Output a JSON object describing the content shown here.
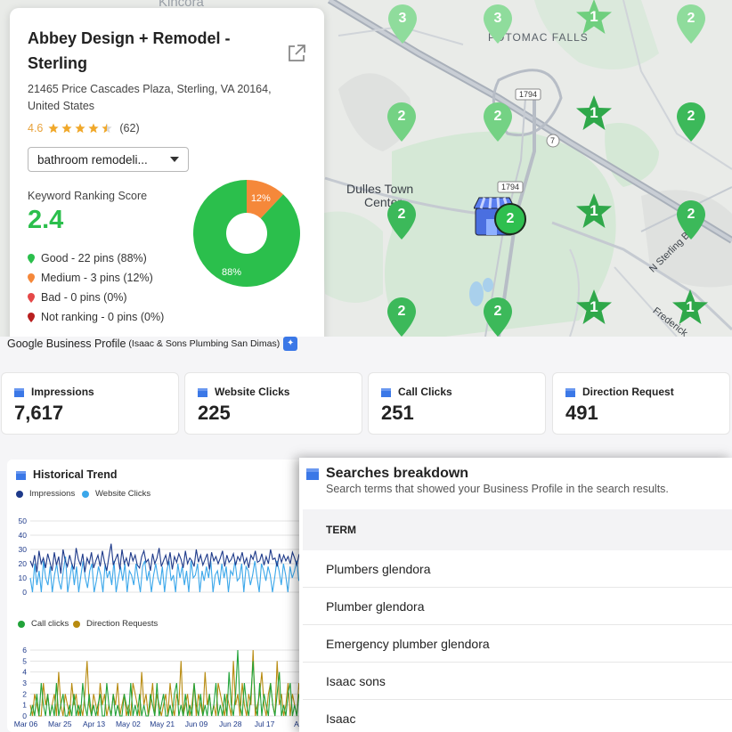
{
  "map": {
    "labels": {
      "town_top": "Kincora",
      "potomac_falls": "POTOMAC FALLS",
      "dulles_line1": "Dulles Town",
      "dulles_line2": "Center",
      "road_1794_a": "1794",
      "road_1794_b": "1794",
      "road_7": "7",
      "n_sterling": "N Sterling Blvd",
      "frederick": "Frederick"
    },
    "pins": [
      {
        "value": "3",
        "kind": "pin",
        "color": "#7fd68f"
      },
      {
        "value": "3",
        "kind": "pin",
        "color": "#7fd68f"
      },
      {
        "value": "1",
        "kind": "star",
        "color": "#5cc868"
      },
      {
        "value": "2",
        "kind": "pin",
        "color": "#7fd68f"
      },
      {
        "value": "2",
        "kind": "pin",
        "color": "#6fcf7e"
      },
      {
        "value": "2",
        "kind": "pin",
        "color": "#6fcf7e"
      },
      {
        "value": "1",
        "kind": "star",
        "color": "#2fa84a"
      },
      {
        "value": "2",
        "kind": "pin",
        "color": "#3cb95a"
      },
      {
        "value": "2",
        "kind": "pin",
        "color": "#3cb95a"
      },
      {
        "value": "1",
        "kind": "star",
        "color": "#2fa84a"
      },
      {
        "value": "2",
        "kind": "pin",
        "color": "#3cb95a"
      },
      {
        "value": "2",
        "kind": "pin",
        "color": "#3cb95a"
      },
      {
        "value": "2",
        "kind": "pin",
        "color": "#3cb95a"
      },
      {
        "value": "1",
        "kind": "star",
        "color": "#2fa84a"
      },
      {
        "value": "1",
        "kind": "star",
        "color": "#2fa84a"
      }
    ],
    "center_value": "2"
  },
  "business": {
    "name": "Abbey Design + Remodel - Sterling",
    "address": "21465 Price Cascades Plaza, Sterling, VA 20164, United States",
    "rating": "4.6",
    "rating_stars": 4.5,
    "review_count": "(62)",
    "keyword": "bathroom remodeli...",
    "score_label": "Keyword Ranking Score",
    "score_value": "2.4",
    "legend": [
      {
        "label": "Good - 22 pins (88%)",
        "color": "#2bbf4c"
      },
      {
        "label": "Medium - 3 pins (12%)",
        "color": "#f5883a"
      },
      {
        "label": "Bad - 0 pins (0%)",
        "color": "#e54848"
      },
      {
        "label": "Not ranking - 0 pins (0%)",
        "color": "#b81f1f"
      }
    ],
    "donut": {
      "good_pct": 88,
      "medium_pct": 12,
      "good_label": "88%",
      "medium_label": "12%",
      "good_color": "#2bbf4c",
      "medium_color": "#f5883a"
    }
  },
  "gbp": {
    "title": "Google Business Profile",
    "subtitle": "(Isaac & Sons Plumbing San Dimas)",
    "stats": [
      {
        "label": "Impressions",
        "value": "7,617"
      },
      {
        "label": "Website Clicks",
        "value": "225"
      },
      {
        "label": "Call Clicks",
        "value": "251"
      },
      {
        "label": "Direction Request",
        "value": "491"
      }
    ]
  },
  "trend": {
    "title": "Historical Trend",
    "legend_top": [
      {
        "label": "Impressions",
        "color": "#1e3a8a"
      },
      {
        "label": "Website Clicks",
        "color": "#3ba7ea"
      }
    ],
    "legend_bottom": [
      {
        "label": "Call clicks",
        "color": "#22a33a"
      },
      {
        "label": "Direction Requests",
        "color": "#b88b10"
      }
    ],
    "x_ticks": [
      "Mar 06",
      "Mar 25",
      "Apr 13",
      "May 02",
      "May 21",
      "Jun 09",
      "Jun 28",
      "Jul 17",
      "Au"
    ]
  },
  "chart_data": [
    {
      "type": "line",
      "title": "Historical Trend",
      "series": [
        {
          "name": "Impressions"
        },
        {
          "name": "Website Clicks"
        }
      ],
      "yticks": [
        "50",
        "40",
        "30",
        "20",
        "10",
        "0"
      ],
      "ylim": [
        0,
        50
      ],
      "x_start": "Mar 06",
      "x_ticks": [
        "Mar 06",
        "Mar 25",
        "Apr 13",
        "May 02",
        "May 21",
        "Jun 09",
        "Jun 28",
        "Jul 17",
        "Au"
      ],
      "impressions": [
        22,
        18,
        26,
        14,
        29,
        20,
        24,
        17,
        27,
        21,
        15,
        28,
        19,
        25,
        13,
        30,
        22,
        18,
        26,
        20,
        16,
        31,
        23,
        19,
        27,
        14,
        24,
        20,
        28,
        17,
        22,
        26,
        18,
        29,
        21,
        15,
        25,
        34,
        19,
        23,
        27,
        16,
        30,
        20,
        24,
        18,
        28,
        22,
        26,
        19,
        17,
        25,
        29,
        21,
        23,
        15,
        27,
        20,
        24,
        31,
        18,
        22,
        26,
        19,
        28,
        16,
        25,
        21,
        27,
        23,
        17,
        29,
        20,
        24,
        22,
        18,
        30,
        21,
        26,
        19,
        23,
        27,
        16,
        28,
        22,
        25,
        20,
        24,
        29,
        18,
        26,
        21,
        23,
        27,
        19,
        25,
        22,
        28,
        20,
        24,
        17,
        26,
        23,
        29,
        21,
        22,
        27,
        19,
        25,
        20,
        30,
        23,
        24,
        18,
        27,
        21,
        26,
        22,
        25,
        20,
        28,
        24,
        19,
        26,
        23,
        27,
        21,
        25,
        22
      ],
      "website_clicks": [
        10,
        0,
        20,
        5,
        15,
        0,
        22,
        10,
        5,
        18,
        0,
        12,
        20,
        8,
        2,
        15,
        25,
        0,
        10,
        20,
        5,
        18,
        0,
        12,
        22,
        10,
        3,
        15,
        20,
        0,
        8,
        18,
        12,
        0,
        20,
        10,
        15,
        5,
        22,
        0,
        10,
        18,
        8,
        20,
        0,
        15,
        12,
        5,
        20,
        10,
        0,
        18,
        22,
        8,
        15,
        0,
        12,
        20,
        10,
        5,
        18,
        0,
        15,
        22,
        8,
        12,
        0,
        20,
        10,
        18,
        5,
        15,
        0,
        22,
        10,
        12,
        20,
        0,
        15,
        8,
        18,
        10,
        22,
        0,
        12,
        15,
        5,
        20,
        10,
        18,
        0,
        15,
        12,
        22,
        8,
        10,
        20,
        0,
        18,
        15,
        5,
        12,
        22,
        10,
        0,
        20,
        15,
        8,
        18,
        12,
        0,
        10,
        22,
        15,
        5,
        20,
        12,
        0,
        18,
        10,
        15,
        22,
        8,
        12,
        20,
        0,
        15,
        10
      ]
    },
    {
      "type": "line",
      "series": [
        {
          "name": "Call clicks"
        },
        {
          "name": "Direction Requests"
        }
      ],
      "yticks": [
        "6",
        "5",
        "4",
        "3",
        "2",
        "1",
        "0"
      ],
      "ylim": [
        0,
        6
      ],
      "call_clicks": [
        0,
        1,
        0,
        2,
        0,
        3,
        1,
        0,
        2,
        0,
        1,
        0,
        3,
        0,
        1,
        2,
        0,
        0,
        1,
        0,
        2,
        0,
        1,
        0,
        3,
        1,
        0,
        2,
        0,
        1,
        0,
        1,
        2,
        0,
        0,
        3,
        1,
        0,
        2,
        0,
        1,
        0,
        0,
        2,
        1,
        0,
        3,
        0,
        1,
        0,
        2,
        0,
        1,
        0,
        0,
        2,
        1,
        0,
        3,
        0,
        1,
        2,
        0,
        0,
        1,
        0,
        2,
        3,
        0,
        1,
        0,
        2,
        0,
        1,
        0,
        3,
        1,
        0,
        2,
        0,
        1,
        0,
        2,
        0,
        1,
        3,
        0,
        1,
        0,
        2,
        0,
        4,
        1,
        0,
        2,
        6,
        1,
        0,
        3,
        1,
        0,
        2,
        5,
        1,
        0,
        3,
        0,
        2,
        1,
        0,
        3,
        1,
        0,
        2,
        4,
        0,
        1,
        0,
        2,
        3,
        0,
        1,
        0,
        2,
        1,
        0,
        3,
        1,
        0
      ],
      "direction_requests": [
        1,
        0,
        2,
        1,
        0,
        0,
        3,
        1,
        2,
        0,
        1,
        2,
        0,
        4,
        1,
        0,
        2,
        1,
        0,
        3,
        1,
        2,
        0,
        1,
        0,
        2,
        5,
        1,
        0,
        2,
        1,
        0,
        3,
        1,
        2,
        0,
        1,
        0,
        2,
        1,
        3,
        0,
        1,
        2,
        0,
        1,
        0,
        3,
        2,
        1,
        0,
        4,
        1,
        2,
        0,
        1,
        3,
        0,
        2,
        1,
        0,
        1,
        2,
        0,
        3,
        1,
        0,
        2,
        1,
        5,
        0,
        1,
        2,
        0,
        1,
        3,
        0,
        2,
        1,
        0,
        4,
        1,
        2,
        0,
        1,
        0,
        3,
        2,
        1,
        0,
        2,
        1,
        0,
        5,
        1,
        2,
        0,
        3,
        1,
        0,
        2,
        1,
        6,
        0,
        1,
        2,
        4,
        1,
        0,
        2,
        3,
        1,
        0,
        5,
        1,
        2,
        0,
        1,
        3,
        0,
        2,
        1,
        0,
        3,
        1,
        2,
        0,
        1,
        2
      ]
    }
  ],
  "searches": {
    "title": "Searches breakdown",
    "subtitle": "Search terms that showed your Business Profile in the search results.",
    "column": "TERM",
    "rows": [
      "Plumbers glendora",
      "Plumber glendora",
      "Emergency plumber glendora",
      "Isaac sons",
      "Isaac"
    ]
  }
}
